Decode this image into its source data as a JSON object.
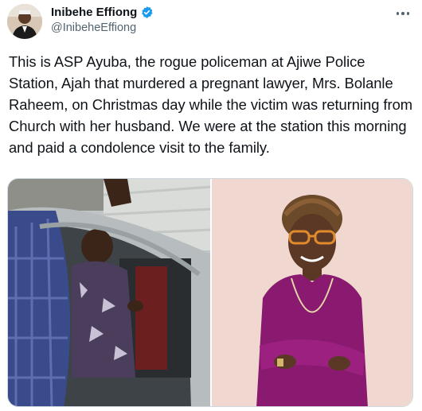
{
  "author": {
    "display_name": "Inibehe Effiong",
    "handle": "@InibeheEffiong",
    "avatar_icon": "person-avatar",
    "verified": true,
    "verified_color": "#1d9bf0"
  },
  "tweet": {
    "text": "This is ASP Ayuba, the rogue policeman at Ajiwe Police Station, Ajah that murdered a pregnant lawyer, Mrs. Bolanle Raheem, on Christmas day while the victim was returning from Church with her husband. We were at the station this morning and paid a condolence visit to the family."
  },
  "media": {
    "photos": [
      {
        "icon": "photo-man-in-car"
      },
      {
        "icon": "photo-woman-portrait"
      }
    ]
  },
  "colors": {
    "text_primary": "#0f1419",
    "text_secondary": "#536471",
    "border": "#cfd9de"
  }
}
